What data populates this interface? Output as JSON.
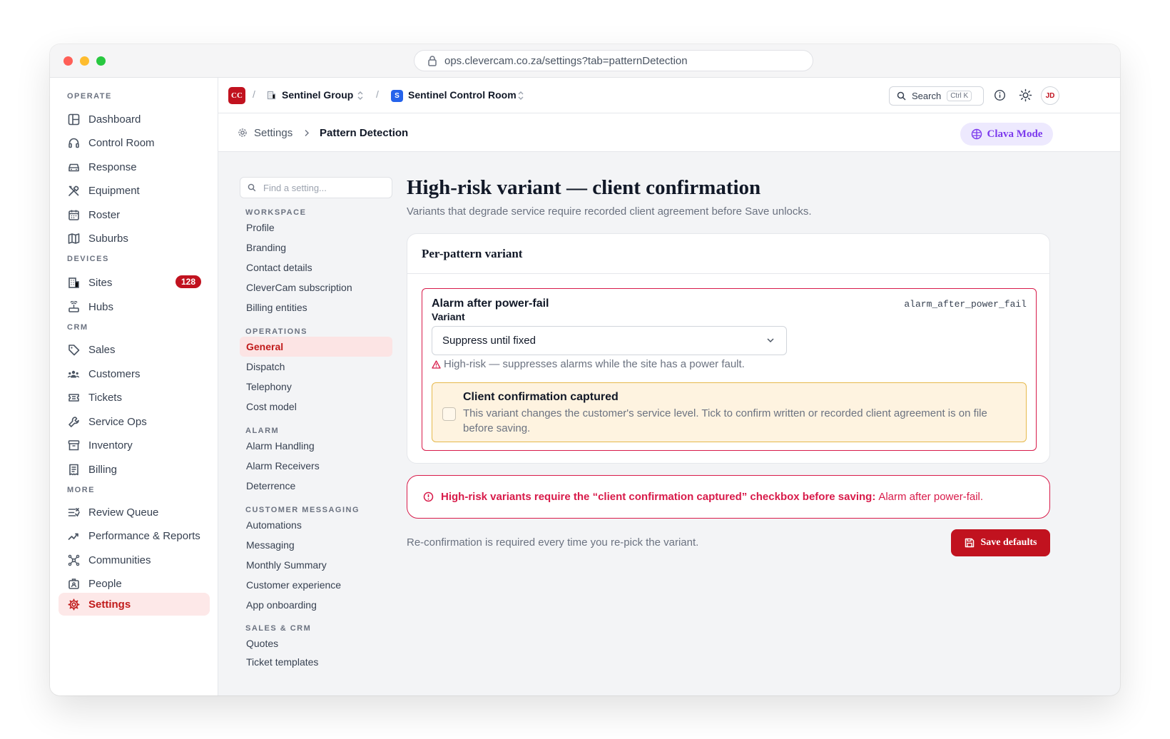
{
  "browser": {
    "url": "ops.clevercam.co.za/settings?tab=patternDetection"
  },
  "sidebar": {
    "sections": [
      {
        "label": "OPERATE"
      },
      {
        "label": "DEVICES"
      },
      {
        "label": "CRM"
      },
      {
        "label": "MORE"
      }
    ],
    "items": [
      {
        "label": "Dashboard",
        "icon": "layout-icon"
      },
      {
        "label": "Control Room",
        "icon": "headset-icon"
      },
      {
        "label": "Response",
        "icon": "car-icon"
      },
      {
        "label": "Equipment",
        "icon": "tools-icon"
      },
      {
        "label": "Roster",
        "icon": "calendar-icon"
      },
      {
        "label": "Suburbs",
        "icon": "map-icon"
      },
      {
        "label": "Sites",
        "icon": "building-icon",
        "badge": "128"
      },
      {
        "label": "Hubs",
        "icon": "router-icon"
      },
      {
        "label": "Sales",
        "icon": "tag-icon"
      },
      {
        "label": "Customers",
        "icon": "users-icon"
      },
      {
        "label": "Tickets",
        "icon": "ticket-icon"
      },
      {
        "label": "Service Ops",
        "icon": "wrench-icon"
      },
      {
        "label": "Inventory",
        "icon": "archive-icon"
      },
      {
        "label": "Billing",
        "icon": "receipt-icon"
      },
      {
        "label": "Review Queue",
        "icon": "list-check-icon"
      },
      {
        "label": "Performance & Reports",
        "icon": "trend-icon"
      },
      {
        "label": "Communities",
        "icon": "network-icon"
      },
      {
        "label": "People",
        "icon": "contacts-icon"
      },
      {
        "label": "Settings",
        "icon": "gear-icon",
        "active": true
      }
    ]
  },
  "topbar": {
    "logo": "CC",
    "sep": "/",
    "org": "Sentinel Group",
    "room_initial": "S",
    "room": "Sentinel Control Room",
    "search_label": "Search",
    "search_kbd": "Ctrl K",
    "avatar": "JD"
  },
  "breadcrumb": {
    "root": "Settings",
    "current": "Pattern Detection",
    "mode_button": "Clava Mode"
  },
  "settings_nav": {
    "placeholder": "Find a setting...",
    "groups": [
      {
        "label": "WORKSPACE",
        "items": [
          "Profile",
          "Branding",
          "Contact details",
          "CleverCam subscription",
          "Billing entities"
        ]
      },
      {
        "label": "OPERATIONS",
        "items": [
          "General",
          "Dispatch",
          "Telephony",
          "Cost model"
        ]
      },
      {
        "label": "ALARM",
        "items": [
          "Alarm Handling",
          "Alarm Receivers",
          "Deterrence"
        ]
      },
      {
        "label": "CUSTOMER MESSAGING",
        "items": [
          "Automations",
          "Messaging",
          "Monthly Summary",
          "Customer experience",
          "App onboarding"
        ]
      },
      {
        "label": "SALES & CRM",
        "items": [
          "Quotes",
          "Ticket templates"
        ]
      }
    ],
    "active": "General"
  },
  "main": {
    "title": "High-risk variant — client confirmation",
    "subtitle": "Variants that degrade service require recorded client agreement before Save unlocks.",
    "card_title": "Per-pattern variant",
    "pattern": {
      "name": "Alarm after power-fail",
      "key": "alarm_after_power_fail",
      "variant_label": "Variant",
      "variant_value": "Suppress until fixed",
      "warning": "High-risk — suppresses alarms while the site has a power fault.",
      "confirm_title": "Client confirmation captured",
      "confirm_text": "This variant changes the customer's service level. Tick to confirm written or recorded client agreement is on file before saving.",
      "confirmed": false
    },
    "error_lead": "High-risk variants require the “client confirmation captured” checkbox before saving:",
    "error_rest": "Alarm after power-fail.",
    "footnote": "Re-confirmation is required every time you re-pick the variant.",
    "save_label": "Save defaults"
  },
  "colors": {
    "brand": "#c1121f",
    "danger": "#d81b4a",
    "warning_bg": "#fef3e0",
    "accent_purple": "#7c3aed"
  }
}
